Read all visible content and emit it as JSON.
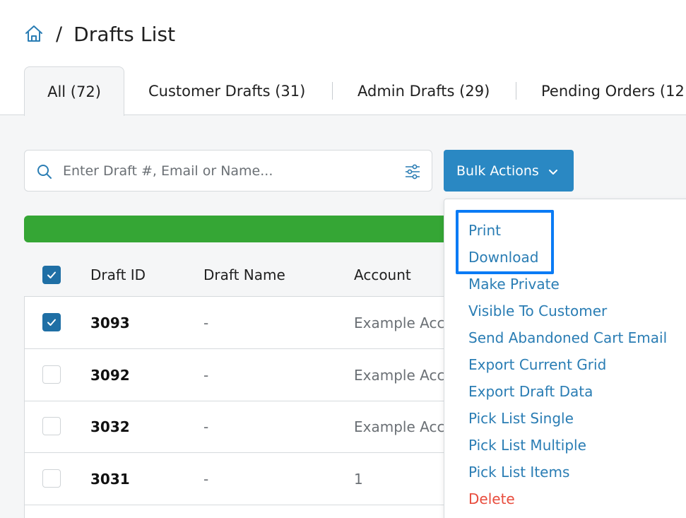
{
  "breadcrumb": {
    "home_icon": "home-icon",
    "separator": "/",
    "title": "Drafts List"
  },
  "tabs": [
    {
      "label": "All (72)",
      "active": true
    },
    {
      "label": "Customer Drafts (31)",
      "active": false
    },
    {
      "label": "Admin Drafts (29)",
      "active": false
    },
    {
      "label": "Pending Orders (12",
      "active": false
    }
  ],
  "search": {
    "placeholder": "Enter Draft #, Email or Name...",
    "value": "",
    "icon": "search-icon",
    "filter_icon": "filter-sliders-icon"
  },
  "bulk_actions": {
    "label": "Bulk Actions",
    "icon": "chevron-down-icon"
  },
  "progress": {
    "percent": 100,
    "color": "#35a635"
  },
  "table": {
    "headers": {
      "draft_id": "Draft ID",
      "draft_name": "Draft Name",
      "account": "Account"
    },
    "select_all_checked": true,
    "rows": [
      {
        "checked": true,
        "id": "3093",
        "name": "-",
        "account": "Example Acc"
      },
      {
        "checked": false,
        "id": "3092",
        "name": "-",
        "account": "Example Acc"
      },
      {
        "checked": false,
        "id": "3032",
        "name": "-",
        "account": "Example Acc"
      },
      {
        "checked": false,
        "id": "3031",
        "name": "-",
        "account": "1"
      }
    ]
  },
  "menu": {
    "items": [
      {
        "label": "Print",
        "danger": false
      },
      {
        "label": "Download",
        "danger": false
      },
      {
        "label": "Make Private",
        "danger": false
      },
      {
        "label": "Visible To Customer",
        "danger": false
      },
      {
        "label": "Send Abandoned Cart Email",
        "danger": false
      },
      {
        "label": "Export Current Grid",
        "danger": false
      },
      {
        "label": "Export Draft Data",
        "danger": false
      },
      {
        "label": "Pick List Single",
        "danger": false
      },
      {
        "label": "Pick List Multiple",
        "danger": false
      },
      {
        "label": "Pick List Items",
        "danger": false
      },
      {
        "label": "Delete",
        "danger": true
      }
    ],
    "highlighted": [
      "Print",
      "Download"
    ]
  },
  "colors": {
    "accent": "#2a88c3",
    "link": "#2a7db4",
    "danger": "#e84c3d",
    "highlight": "#0a7bf5",
    "checkbox": "#1f6fa5"
  }
}
